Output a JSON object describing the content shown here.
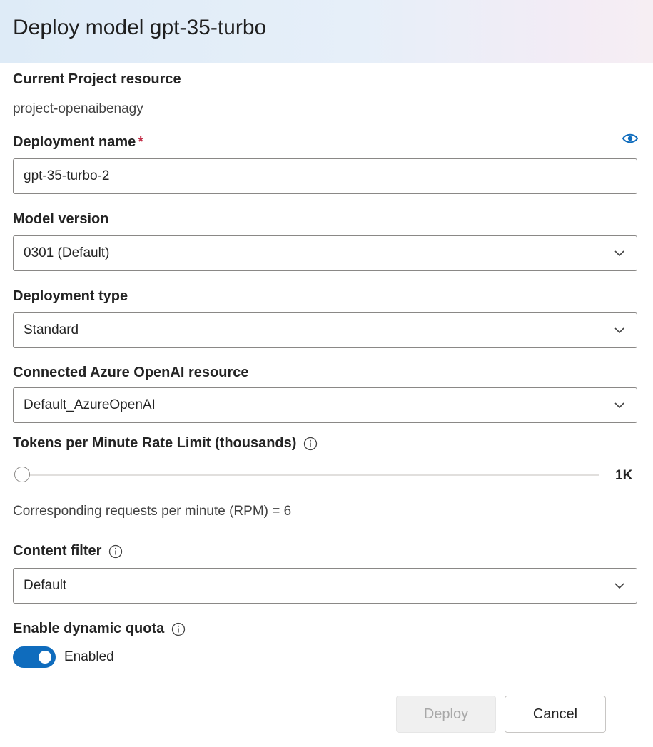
{
  "dialog": {
    "title": "Deploy model gpt-35-turbo"
  },
  "project": {
    "label": "Current Project resource",
    "value": "project-openaibenagy"
  },
  "deployment_name": {
    "label": "Deployment name",
    "required_mark": "*",
    "value": "gpt-35-turbo-2",
    "icon": "eye-icon"
  },
  "model_version": {
    "label": "Model version",
    "value": "0301 (Default)"
  },
  "deployment_type": {
    "label": "Deployment type",
    "value": "Standard"
  },
  "azure_resource": {
    "label": "Connected Azure OpenAI resource",
    "value": "Default_AzureOpenAI"
  },
  "rate_limit": {
    "label": "Tokens per Minute Rate Limit (thousands)",
    "slider_value_label": "1K",
    "slider_fraction": 0.0,
    "rpm_text": "Corresponding requests per minute (RPM) = 6"
  },
  "content_filter": {
    "label": "Content filter",
    "value": "Default"
  },
  "dynamic_quota": {
    "label": "Enable dynamic quota",
    "toggle_label": "Enabled",
    "enabled": true
  },
  "buttons": {
    "deploy": "Deploy",
    "cancel": "Cancel"
  },
  "colors": {
    "accent": "#0f6cbd",
    "required": "#c4314b",
    "header_gradient_start": "#deebf7",
    "header_gradient_end": "#f6eef3"
  }
}
